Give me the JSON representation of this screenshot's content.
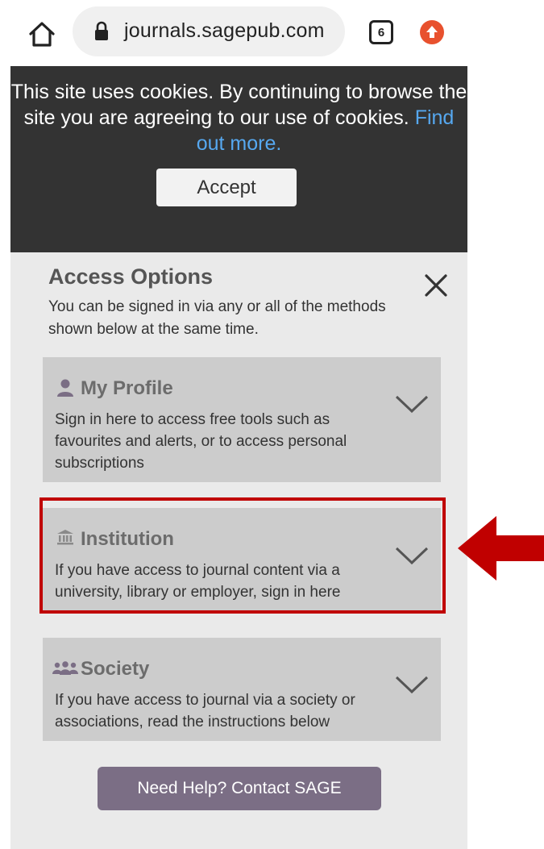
{
  "browser": {
    "url": "journals.sagepub.com",
    "tab_count": "6"
  },
  "cookie_banner": {
    "text": "This site uses cookies. By continuing to browse the site you are agreeing to our use of cookies.",
    "link": "Find out more.",
    "accept_label": "Accept"
  },
  "access": {
    "title": "Access Options",
    "description": "You can be signed in via any or all of the methods shown below at the same time.",
    "options": [
      {
        "title": "My Profile",
        "description": "Sign in here to access free tools such as favourites and alerts, or to access personal subscriptions",
        "icon": "person-icon"
      },
      {
        "title": "Institution",
        "description": "If you have access to journal content via a university, library or employer, sign in here",
        "icon": "institution-icon"
      },
      {
        "title": "Society",
        "description": "If you have access to journal via a society or associations, read the instructions below",
        "icon": "group-icon"
      }
    ],
    "help_label": "Need Help? Contact SAGE"
  },
  "colors": {
    "cookie_bg": "#333333",
    "link": "#56a8f0",
    "panel_bg": "#eaeaea",
    "card_bg": "#cccccc",
    "help_button": "#7b6e85",
    "highlight": "#c00000"
  }
}
